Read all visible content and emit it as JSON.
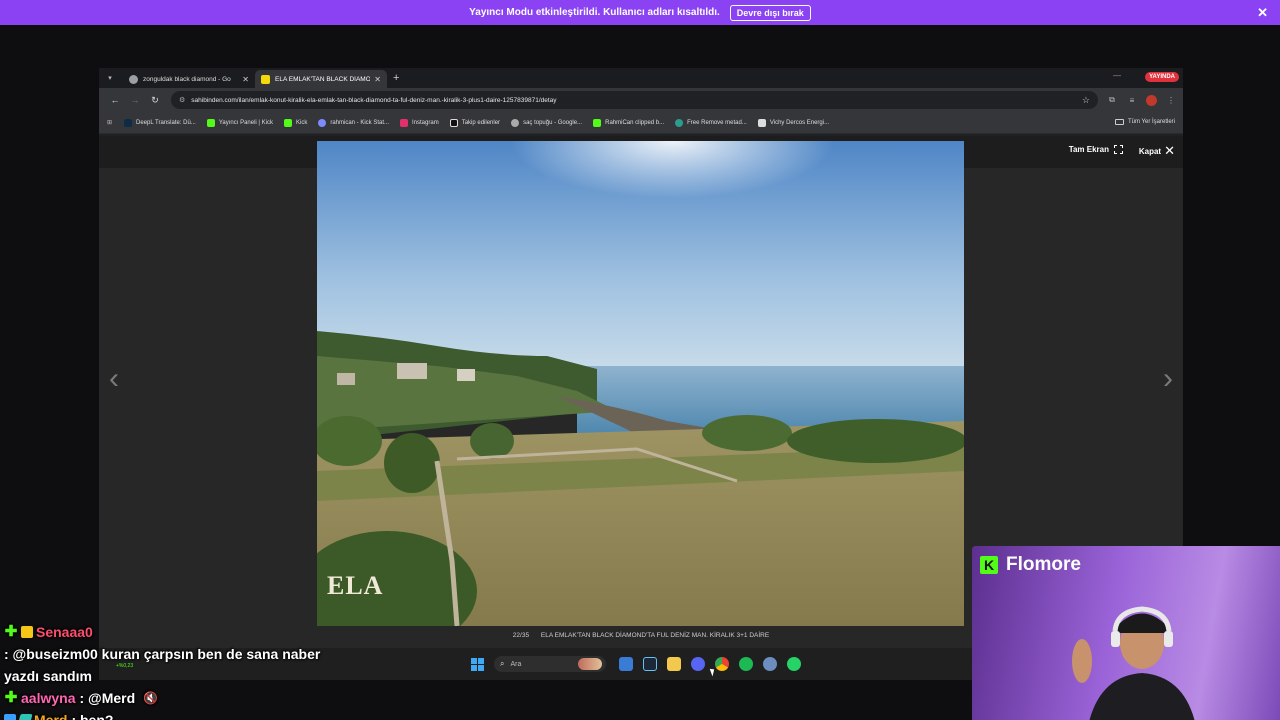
{
  "banner": {
    "text": "Yayıncı Modu etkinleştirildi. Kullanıcı adları kısaltıldı.",
    "button": "Devre dışı bırak",
    "close": "✕"
  },
  "browser": {
    "tabs": [
      {
        "title": "zonguldak black diamond - Go",
        "active": false,
        "favicon_color": "#9aa0a6"
      },
      {
        "title": "ELA EMLAK'TAN BLACK DİAMO",
        "active": true,
        "favicon_color": "#f5d90a"
      }
    ],
    "new_tab": "+",
    "minimize": "—",
    "live_badge": "YAYINDA",
    "url": "sahibinden.com/ilan/emlak-konut-kiralik-ela-emlak-tan-black-diamond-ta-ful-deniz-man.-kiralik-3-plus1-daire-1257839871/detay",
    "bookmarks": [
      {
        "label": "DeepL Translate: Dü...",
        "color": "#0f2b46"
      },
      {
        "label": "Yayıncı Paneli | Kick",
        "color": "#53fc18"
      },
      {
        "label": "Kick",
        "color": "#53fc18"
      },
      {
        "label": "rahmican - Kick Stat...",
        "color": "#7c8cff"
      },
      {
        "label": "Instagram",
        "color": "#e1306c"
      },
      {
        "label": "Takip edilenler",
        "color": "#dddddd"
      },
      {
        "label": "saç topuğu - Google...",
        "color": "#aaaaaa"
      },
      {
        "label": "RahmiCan clipped b...",
        "color": "#53fc18"
      },
      {
        "label": "Free Remove metad...",
        "color": "#2a9d8f"
      },
      {
        "label": "Vichy Dercos Energi...",
        "color": "#dddddd"
      }
    ],
    "all_bookmarks": "Tüm Yer İşaretleri"
  },
  "viewer": {
    "fullscreen": "Tam Ekran",
    "close": "Kapat",
    "counter": "22/35",
    "caption": "ELA EMLAK'TAN BLACK DİAMOND'TA FUL DENİZ MAN. KİRALIK 3+1 DAİRE",
    "logo": "ELA",
    "prev": "‹",
    "next": "›"
  },
  "taskbar": {
    "search_placeholder": "Ara",
    "apps": [
      {
        "name": "explorer-widgets",
        "color": "#3a7bd5"
      },
      {
        "name": "steam",
        "color": "#1b2838"
      },
      {
        "name": "files",
        "color": "#f2c94c"
      },
      {
        "name": "discord",
        "color": "#5865f2"
      },
      {
        "name": "chrome",
        "color": "#ea4335"
      },
      {
        "name": "spotify",
        "color": "#1db954"
      },
      {
        "name": "vpn",
        "color": "#6c8ebf"
      },
      {
        "name": "whatsapp",
        "color": "#25d366"
      }
    ]
  },
  "webcam": {
    "name": "Flomore",
    "logo": "K"
  },
  "chat": {
    "messages": [
      {
        "user": "Senaaa0",
        "user_color": "#ff4d6d",
        "text": ": @buseizm00 kuran çarpsın ben de sana naber yazdı sandım",
        "badges": [
          "plus",
          "crown"
        ]
      },
      {
        "user": "aalwyna",
        "user_color": "#ff66b3",
        "text": ": @Merd",
        "badges": [
          "plus"
        ],
        "muted": true
      },
      {
        "user": "Merd",
        "user_color": "#f5a623",
        "text": ": ben?",
        "badges": [
          "blue",
          "teal"
        ]
      }
    ],
    "mini_overlay": "+%0,23"
  }
}
